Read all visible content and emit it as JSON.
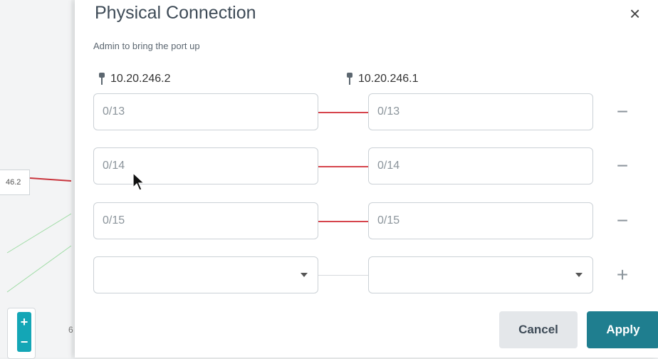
{
  "background": {
    "node_label": "46.2",
    "zoom_in": "+",
    "zoom_out": "−",
    "partial_digit": "6"
  },
  "dialog": {
    "title": "Physical Connection",
    "close_icon": "×",
    "subtitle": "Admin to bring the port up",
    "device_a": "10.20.246.2",
    "device_b": "10.20.246.1",
    "connections": [
      {
        "left": "0/13",
        "right": "0/13",
        "action": "−"
      },
      {
        "left": "0/14",
        "right": "0/14",
        "action": "−"
      },
      {
        "left": "0/15",
        "right": "0/15",
        "action": "−"
      }
    ],
    "new_connection": {
      "left": "",
      "right": "",
      "action": "+"
    },
    "cancel_label": "Cancel",
    "apply_label": "Apply"
  },
  "colors": {
    "link_active": "#d6444c",
    "apply_bg": "#1f7e8f",
    "zoom_bg": "#13a6b6"
  }
}
